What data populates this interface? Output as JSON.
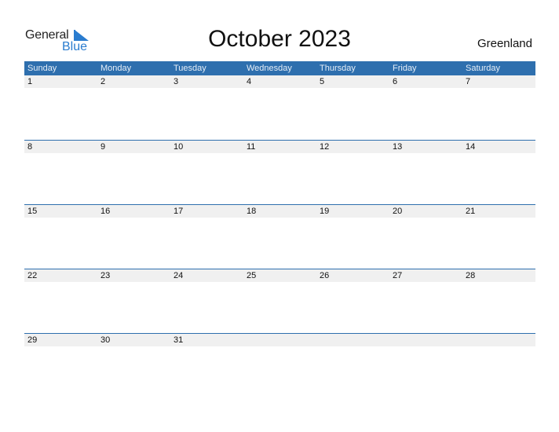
{
  "logo": {
    "line1": "General",
    "line2": "Blue",
    "accent": "#2a7ccf"
  },
  "header": {
    "title": "October 2023",
    "region": "Greenland"
  },
  "colors": {
    "header_bg": "#2e6fae",
    "day_bar_bg": "#f0f0f0"
  },
  "weekdays": [
    "Sunday",
    "Monday",
    "Tuesday",
    "Wednesday",
    "Thursday",
    "Friday",
    "Saturday"
  ],
  "weeks": [
    [
      "1",
      "2",
      "3",
      "4",
      "5",
      "6",
      "7"
    ],
    [
      "8",
      "9",
      "10",
      "11",
      "12",
      "13",
      "14"
    ],
    [
      "15",
      "16",
      "17",
      "18",
      "19",
      "20",
      "21"
    ],
    [
      "22",
      "23",
      "24",
      "25",
      "26",
      "27",
      "28"
    ],
    [
      "29",
      "30",
      "31",
      "",
      "",
      "",
      ""
    ]
  ]
}
